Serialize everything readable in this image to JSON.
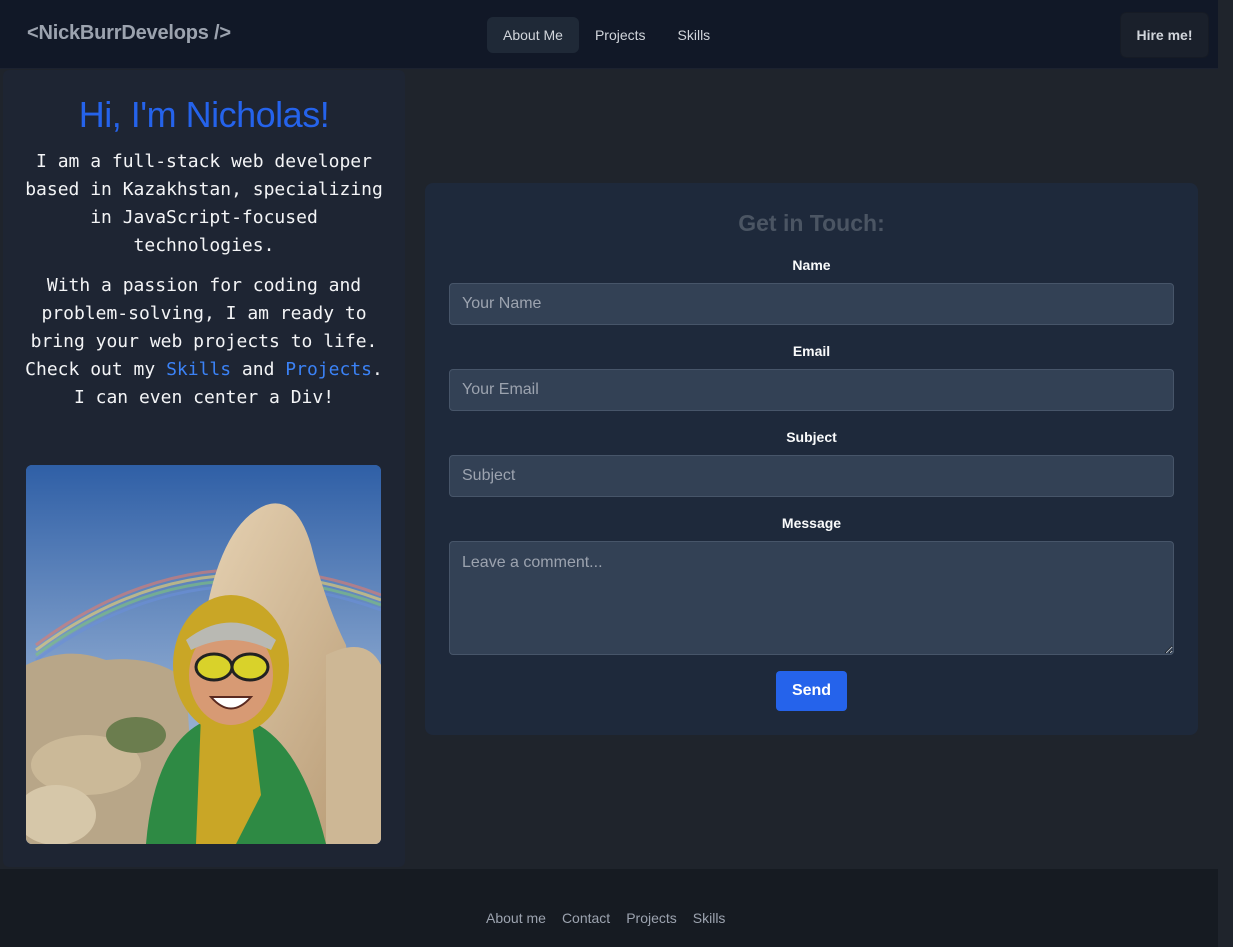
{
  "navbar": {
    "brand": "<NickBurrDevelops />",
    "links": [
      {
        "label": "About Me",
        "active": true
      },
      {
        "label": "Projects",
        "active": false
      },
      {
        "label": "Skills",
        "active": false
      }
    ],
    "hire_button": "Hire me!"
  },
  "profile": {
    "greeting": "Hi, I'm Nicholas!",
    "bio_paragraph_1": "I am a full-stack web developer based in Kazakhstan, specializing in JavaScript-focused technologies.",
    "bio_paragraph_2_prefix": "With a passion for coding and problem-solving, I am ready to bring your web projects to life. Check out my ",
    "bio_link_skills": "Skills",
    "bio_paragraph_2_mid": " and ",
    "bio_link_projects": "Projects",
    "bio_paragraph_2_suffix": ". I can even center a Div!"
  },
  "contact": {
    "title": "Get in Touch:",
    "fields": {
      "name": {
        "label": "Name",
        "placeholder": "Your Name",
        "value": ""
      },
      "email": {
        "label": "Email",
        "placeholder": "Your Email",
        "value": ""
      },
      "subject": {
        "label": "Subject",
        "placeholder": "Subject",
        "value": ""
      },
      "message": {
        "label": "Message",
        "placeholder": "Leave a comment...",
        "value": ""
      }
    },
    "send_button": "Send"
  },
  "footer": {
    "links": [
      "About me",
      "Contact",
      "Projects",
      "Skills"
    ]
  },
  "colors": {
    "accent": "#2563eb",
    "link": "#3b82f6"
  }
}
